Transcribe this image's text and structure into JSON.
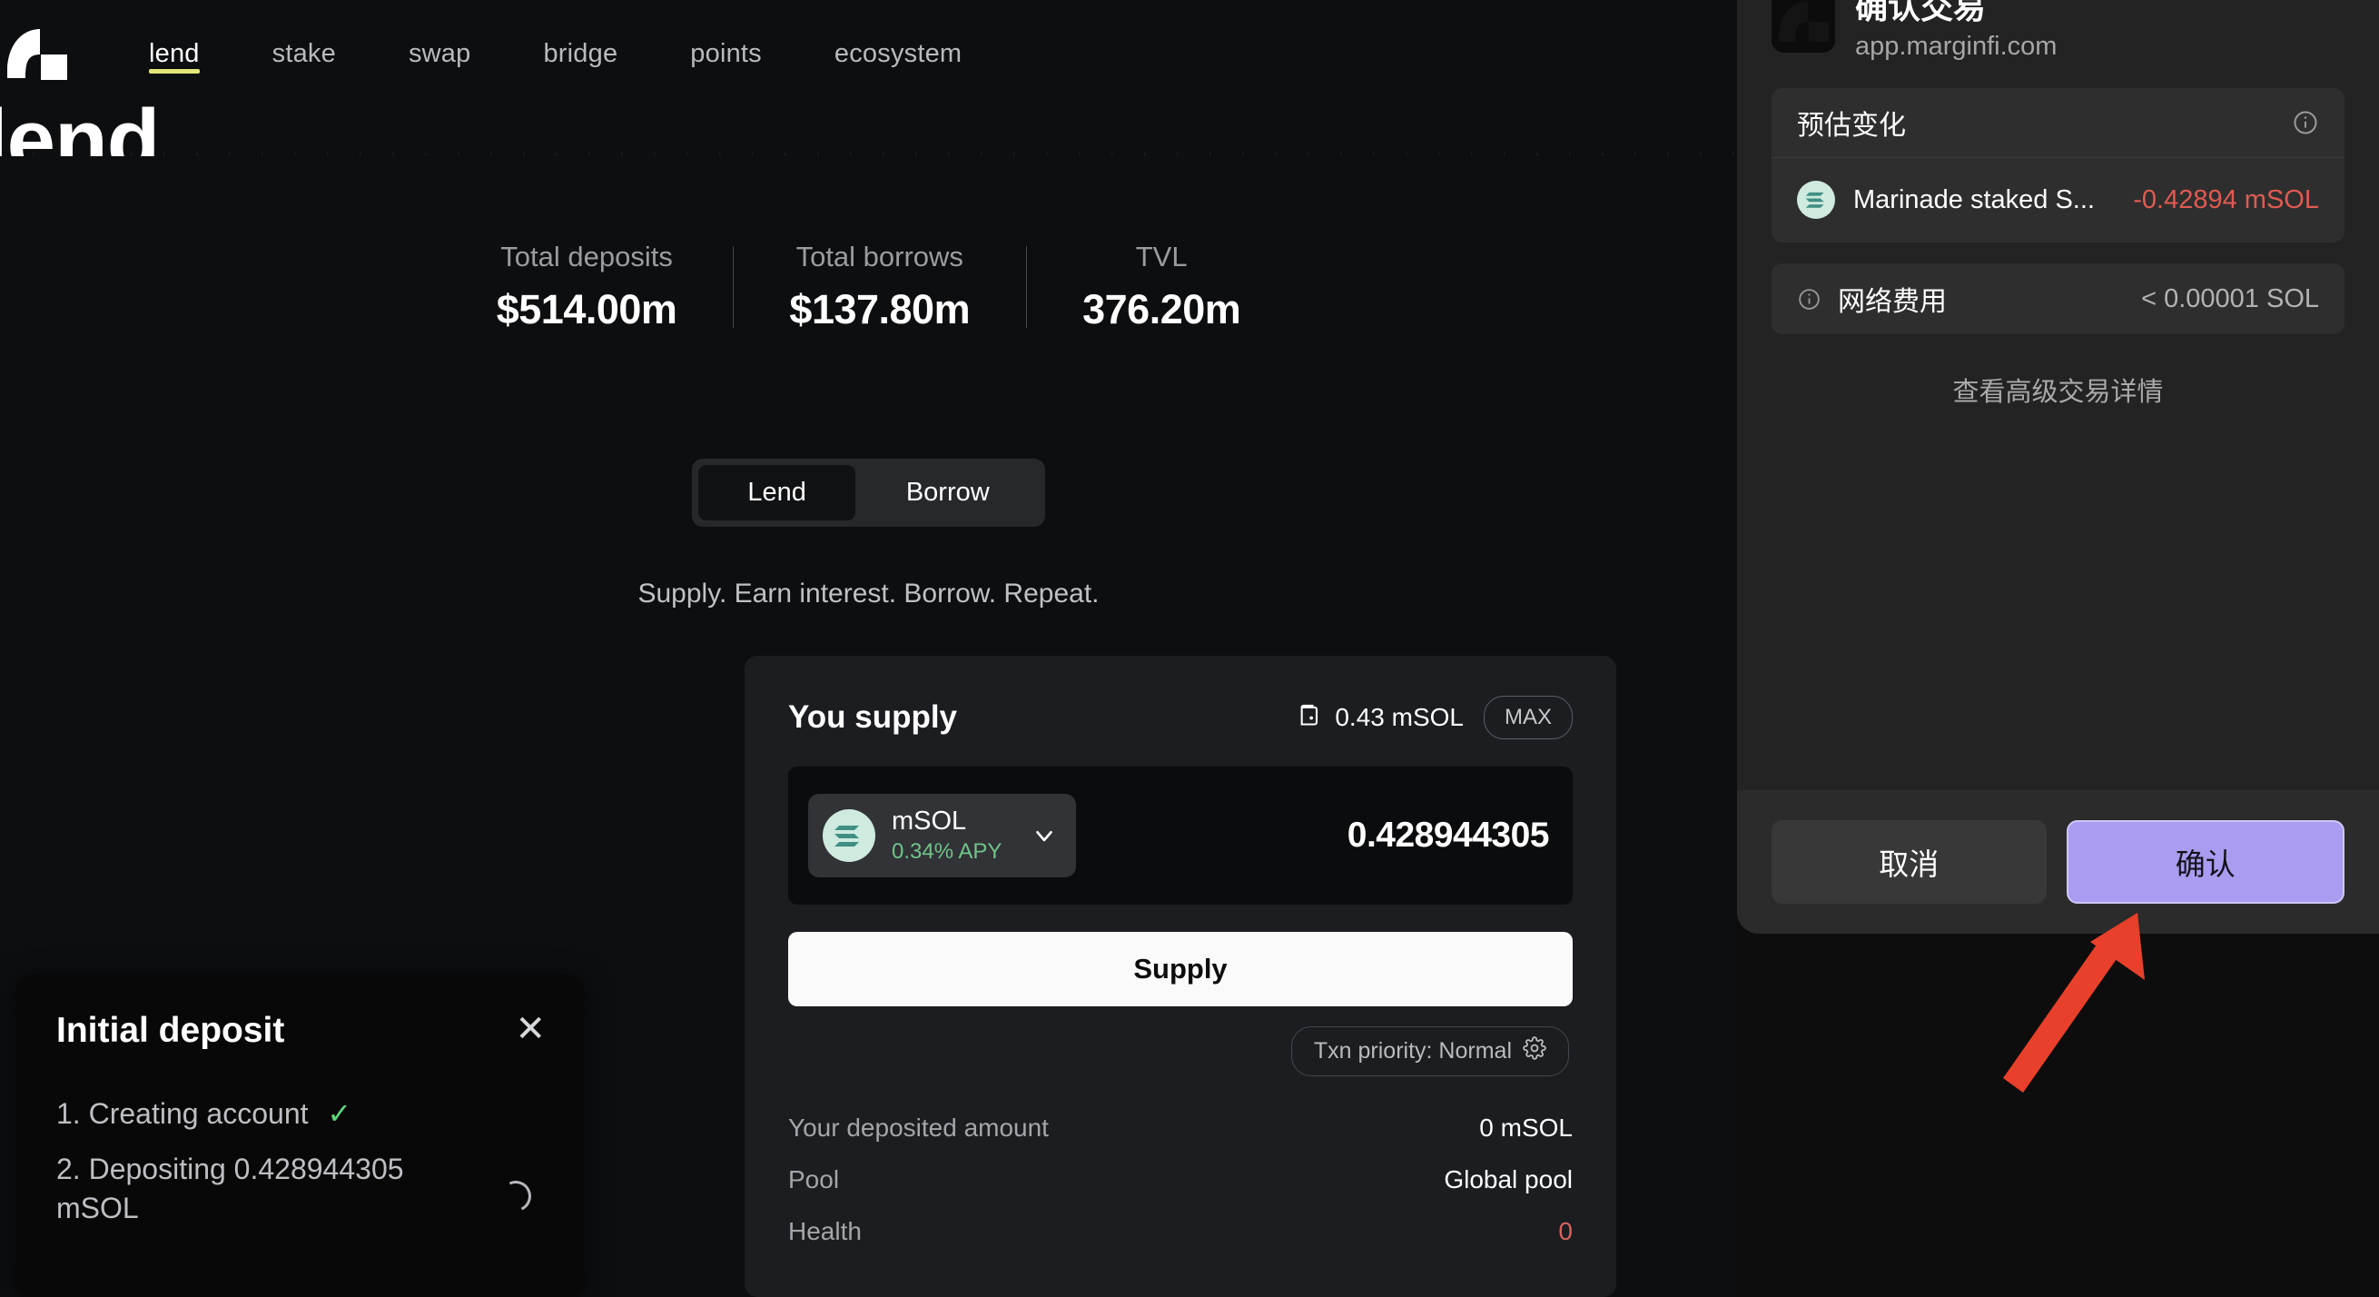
{
  "brand": {
    "logo_icon": "marginfi-logo",
    "accent": "#e3e77a"
  },
  "nav": {
    "items": [
      {
        "label": "lend",
        "active": true
      },
      {
        "label": "stake",
        "active": false
      },
      {
        "label": "swap",
        "active": false
      },
      {
        "label": "bridge",
        "active": false
      },
      {
        "label": "points",
        "active": false
      },
      {
        "label": "ecosystem",
        "active": false
      }
    ]
  },
  "hero": {
    "title": "lend"
  },
  "stats": [
    {
      "label": "Total deposits",
      "value": "$514.00m"
    },
    {
      "label": "Total borrows",
      "value": "$137.80m"
    },
    {
      "label": "TVL",
      "value": "376.20m"
    }
  ],
  "mode_toggle": {
    "options": [
      {
        "label": "Lend",
        "active": true
      },
      {
        "label": "Borrow",
        "active": false
      }
    ]
  },
  "tagline": "Supply. Earn interest. Borrow. Repeat.",
  "supply_card": {
    "title": "You supply",
    "wallet_icon": "wallet-icon",
    "wallet_balance": "0.43 mSOL",
    "max_label": "MAX",
    "token": {
      "logo_icon": "msol-token-icon",
      "symbol": "mSOL",
      "apy": "0.34% APY",
      "chevron_icon": "chevron-down-icon"
    },
    "amount_value": "0.428944305",
    "amount_placeholder": "0",
    "submit_label": "Supply",
    "priority": {
      "label": "Txn priority: Normal",
      "icon": "gear-icon"
    },
    "details": [
      {
        "key": "Your deposited amount",
        "value": "0 mSOL",
        "danger": false
      },
      {
        "key": "Pool",
        "value": "Global pool",
        "danger": false
      },
      {
        "key": "Health",
        "value": "0",
        "danger": true
      }
    ]
  },
  "toast": {
    "title": "Initial deposit",
    "close_icon": "close-icon",
    "steps": [
      {
        "text": "1. Creating account",
        "status": "done",
        "status_icon": "check-icon"
      },
      {
        "text": "2. Depositing 0.428944305 mSOL",
        "status": "pending",
        "status_icon": "spinner-icon"
      }
    ]
  },
  "wallet_panel": {
    "title": "确认交易",
    "host": "app.marginfi.com",
    "site_icon": "marginfi-site-icon",
    "estimated_changes": {
      "heading": "预估变化",
      "info_icon": "info-icon",
      "rows": [
        {
          "token_icon": "msol-token-icon",
          "name": "Marinade staked S...",
          "value": "-0.42894 mSOL",
          "negative": true
        }
      ]
    },
    "network_fee": {
      "info_icon": "info-icon",
      "label": "网络费用",
      "value": "< 0.00001 SOL"
    },
    "advanced_link": "查看高级交易详情",
    "cancel_label": "取消",
    "confirm_label": "确认",
    "confirm_color": "#aa9cf0"
  },
  "annotation": {
    "arrow_icon": "red-arrow-up-right",
    "color": "#e8402a"
  }
}
